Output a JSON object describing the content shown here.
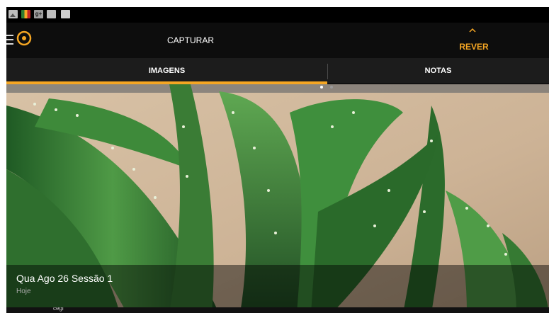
{
  "status_bar": {
    "icons": [
      "gallery-icon",
      "app-grid-icon",
      "google-plus-icon",
      "mail-icon",
      "camera-upload-icon"
    ]
  },
  "action_bar": {
    "tabs": [
      {
        "label": "CAPTURAR",
        "active": false
      },
      {
        "label": "REVER",
        "active": true
      }
    ]
  },
  "sub_tabs": [
    {
      "label": "IMAGENS",
      "active": true
    },
    {
      "label": "NOTAS",
      "active": false
    }
  ],
  "gallery": {
    "page_count": 2,
    "current_page": 1,
    "session": {
      "title": "Qua Ago 26 Sessão 1",
      "subtitle": "Hoje"
    },
    "next_item_label": "cegi"
  },
  "colors": {
    "accent": "#f5a623",
    "bar": "#0d0d0d",
    "subtabs": "#1c1c1c"
  }
}
